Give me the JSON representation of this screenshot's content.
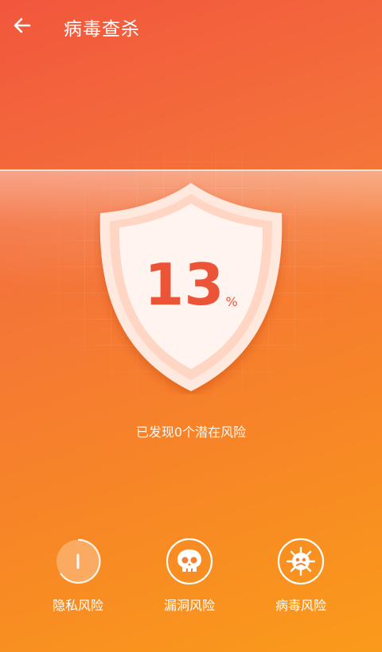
{
  "header": {
    "back_icon": "arrow-left-icon",
    "title": "病毒查杀"
  },
  "scan": {
    "progress_value": "13",
    "progress_unit": "%",
    "progress_fraction": 0.13,
    "status_text": "已发现0个潜在风险"
  },
  "risks": [
    {
      "label": "隐私风险",
      "icon": "privacy-scan-icon",
      "state": "scanning"
    },
    {
      "label": "漏洞风险",
      "icon": "skull-icon",
      "state": "pending"
    },
    {
      "label": "病毒风险",
      "icon": "virus-icon",
      "state": "pending"
    }
  ],
  "colors": {
    "gradient_top": "#f2563d",
    "gradient_bottom": "#fa9a1a",
    "accent_red": "#ec5437",
    "shield_fill": "#fff4ef"
  }
}
